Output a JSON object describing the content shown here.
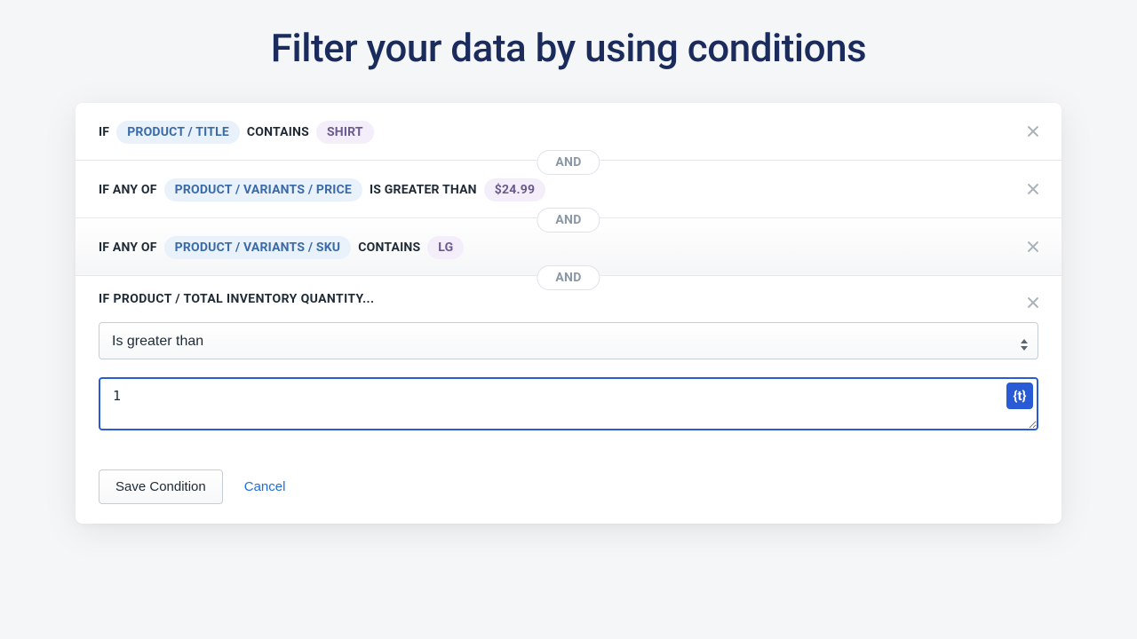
{
  "header": {
    "title": "Filter your data by using conditions"
  },
  "connector_label": "AND",
  "conditions": [
    {
      "prefix": "IF",
      "field": "PRODUCT / TITLE",
      "operator": "CONTAINS",
      "value": "SHIRT"
    },
    {
      "prefix": "IF ANY OF",
      "field": "PRODUCT / VARIANTS / PRICE",
      "operator": "IS GREATER THAN",
      "value": "$24.99"
    },
    {
      "prefix": "IF ANY OF",
      "field": "PRODUCT / VARIANTS / SKU",
      "operator": "CONTAINS",
      "value": "LG"
    }
  ],
  "editing": {
    "title": "IF PRODUCT / TOTAL INVENTORY QUANTITY...",
    "select_value": "Is greater than",
    "input_value": "1",
    "token_label": "{t}"
  },
  "footer": {
    "save_label": "Save Condition",
    "cancel_label": "Cancel"
  }
}
